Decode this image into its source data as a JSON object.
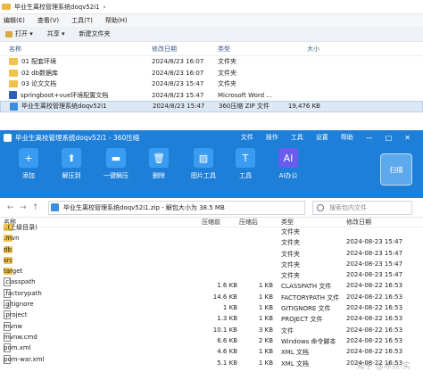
{
  "explorer": {
    "path": [
      "毕业生离校管理系统doqv52i1",
      "›"
    ],
    "menu": [
      "编辑(E)",
      "查看(V)",
      "工具(T)",
      "帮助(H)"
    ],
    "toolbar": [
      "打开 ▾",
      "共享 ▾",
      "新建文件夹"
    ],
    "columns": {
      "name": "名称",
      "date": "修改日期",
      "type": "类型",
      "size": "大小"
    },
    "rows": [
      {
        "name": "01 配套环境",
        "date": "2024/8/23 16:07",
        "type": "文件夹",
        "size": "",
        "kind": "folder"
      },
      {
        "name": "02 db数据库",
        "date": "2024/8/23 16:07",
        "type": "文件夹",
        "size": "",
        "kind": "folder"
      },
      {
        "name": "03 论文文档",
        "date": "2024/8/23 15:47",
        "type": "文件夹",
        "size": "",
        "kind": "folder"
      },
      {
        "name": "springboot+vue环境配置文档",
        "date": "2024/8/23 15:47",
        "type": "Microsoft Word ...",
        "size": "",
        "kind": "word"
      },
      {
        "name": "毕业生离校管理系统doqv52i1",
        "date": "2024/8/23 15:47",
        "type": "360压缩 ZIP 文件",
        "size": "19,476 KB",
        "kind": "zip"
      }
    ]
  },
  "zip": {
    "title": "毕业生离校管理系统doqv52i1 - 360压缩",
    "menu": [
      "文件",
      "操作",
      "工具",
      "设置",
      "帮助"
    ],
    "window_controls": [
      "—",
      "□",
      "✕"
    ],
    "tools": [
      {
        "label": "添加",
        "icon": "add-icon",
        "glyph": "+",
        "color": "#3a9cf0"
      },
      {
        "label": "解压到",
        "icon": "extract-to-icon",
        "glyph": "⬆",
        "color": "#3a9cf0"
      },
      {
        "label": "一键解压",
        "icon": "one-click-extract-icon",
        "glyph": "▬",
        "color": "#3a9cf0"
      },
      {
        "label": "删除",
        "icon": "delete-icon",
        "glyph": "🗑",
        "color": "#3a9cf0"
      },
      {
        "label": "图片工具",
        "icon": "image-tool-icon",
        "glyph": "▨",
        "color": "#3a9cf0"
      },
      {
        "label": "工具",
        "icon": "tools-icon",
        "glyph": "T",
        "color": "#3a9cf0"
      },
      {
        "label": "AI办公",
        "icon": "ai-office-icon",
        "glyph": "AI",
        "color": "#6a5cf0"
      }
    ],
    "scan_label": "扫描",
    "address": "毕业生离校管理系统doqv52i1.zip - 解包大小为 38.5 MB",
    "search_placeholder": "搜索包内文件",
    "columns": {
      "name": "名称",
      "orig": "压缩前",
      "comp": "压缩后",
      "type": "类型",
      "mod": "修改日期"
    },
    "rows": [
      {
        "name": "..(上级目录)",
        "orig": "",
        "comp": "",
        "type": "文件夹",
        "mod": "",
        "kind": "folder"
      },
      {
        "name": ".mvn",
        "orig": "",
        "comp": "",
        "type": "文件夹",
        "mod": "2024-08-23 15:47",
        "kind": "folder"
      },
      {
        "name": "db",
        "orig": "",
        "comp": "",
        "type": "文件夹",
        "mod": "2024-08-23 15:47",
        "kind": "folder"
      },
      {
        "name": "src",
        "orig": "",
        "comp": "",
        "type": "文件夹",
        "mod": "2024-08-23 15:47",
        "kind": "folder"
      },
      {
        "name": "target",
        "orig": "",
        "comp": "",
        "type": "文件夹",
        "mod": "2024-08-23 15:47",
        "kind": "folder"
      },
      {
        "name": ".classpath",
        "orig": "1.6 KB",
        "comp": "1 KB",
        "type": "CLASSPATH 文件",
        "mod": "2024-08-22 16:53",
        "kind": "file"
      },
      {
        "name": ".factorypath",
        "orig": "14.6 KB",
        "comp": "1 KB",
        "type": "FACTORYPATH 文件",
        "mod": "2024-08-22 16:53",
        "kind": "file"
      },
      {
        "name": ".gitignore",
        "orig": "1 KB",
        "comp": "1 KB",
        "type": "GITIGNORE 文件",
        "mod": "2024-08-22 16:53",
        "kind": "file"
      },
      {
        "name": ".project",
        "orig": "1.3 KB",
        "comp": "1 KB",
        "type": "PROJECT 文件",
        "mod": "2024-08-22 16:53",
        "kind": "file"
      },
      {
        "name": "mvnw",
        "orig": "10.1 KB",
        "comp": "3 KB",
        "type": "文件",
        "mod": "2024-08-22 16:53",
        "kind": "file"
      },
      {
        "name": "mvnw.cmd",
        "orig": "6.6 KB",
        "comp": "2 KB",
        "type": "Windows 命令脚本",
        "mod": "2024-08-22 16:53",
        "kind": "file"
      },
      {
        "name": "pom.xml",
        "orig": "4.6 KB",
        "comp": "1 KB",
        "type": "XML 文档",
        "mod": "2024-08-22 16:53",
        "kind": "file"
      },
      {
        "name": "pom-war.xml",
        "orig": "5.1 KB",
        "comp": "1 KB",
        "type": "XML 文档",
        "mod": "2024-08-22 16:53",
        "kind": "file"
      }
    ],
    "watermark": "知乎 @冰点-实"
  }
}
